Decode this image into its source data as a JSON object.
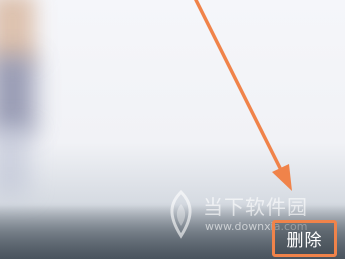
{
  "action": {
    "delete_label": "删除"
  },
  "watermark": {
    "brand_text": "当下软件园",
    "url_text": "www.downxia.com"
  },
  "annotation": {
    "highlight_color": "#f0834a"
  }
}
